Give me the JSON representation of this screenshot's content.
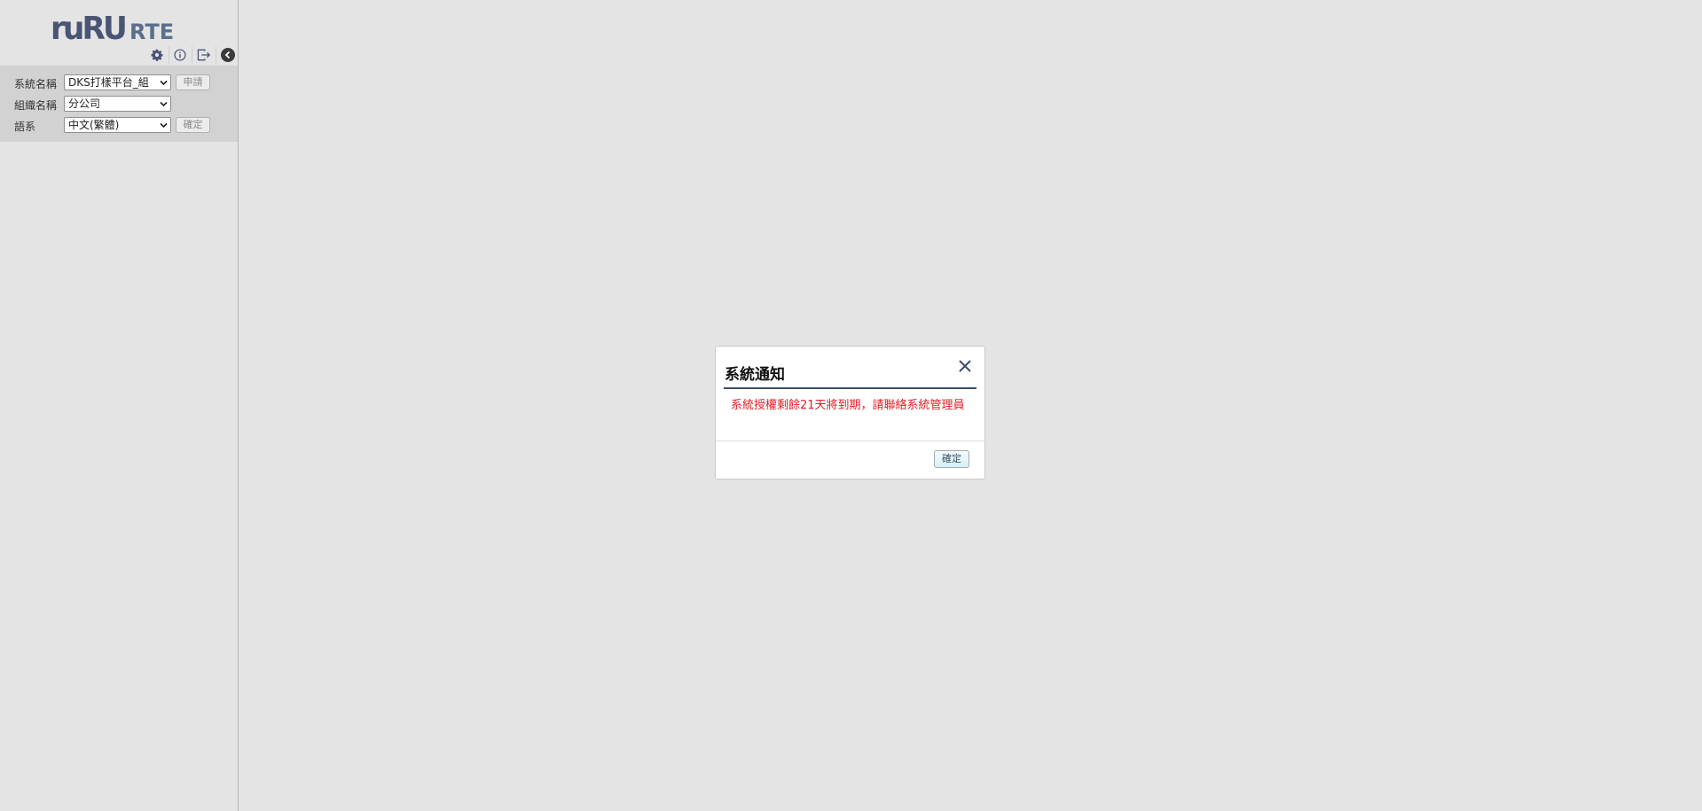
{
  "sidebar": {
    "logo": {
      "text_left": "ruRU",
      "text_right": "RTE",
      "colors": {
        "left": "#4a5575",
        "right": "#5a6f8c"
      }
    },
    "toolbar": {
      "icons": [
        "gear-icon",
        "info-icon",
        "logout-icon",
        "collapse-icon"
      ]
    },
    "form": {
      "system_label": "系統名稱",
      "system_value": "DKS打樣平台_組",
      "apply_label": "申請",
      "org_label": "組織名稱",
      "org_value": "分公司",
      "lang_label": "語系",
      "lang_value": "中文(繁體)",
      "confirm_label": "確定"
    }
  },
  "modal": {
    "title": "系統通知",
    "message": "系統授權剩餘21天將到期，請聯絡系統管理員",
    "ok_label": "確定",
    "colors": {
      "message": "#e51c23",
      "rule": "#3d4b6e"
    }
  }
}
